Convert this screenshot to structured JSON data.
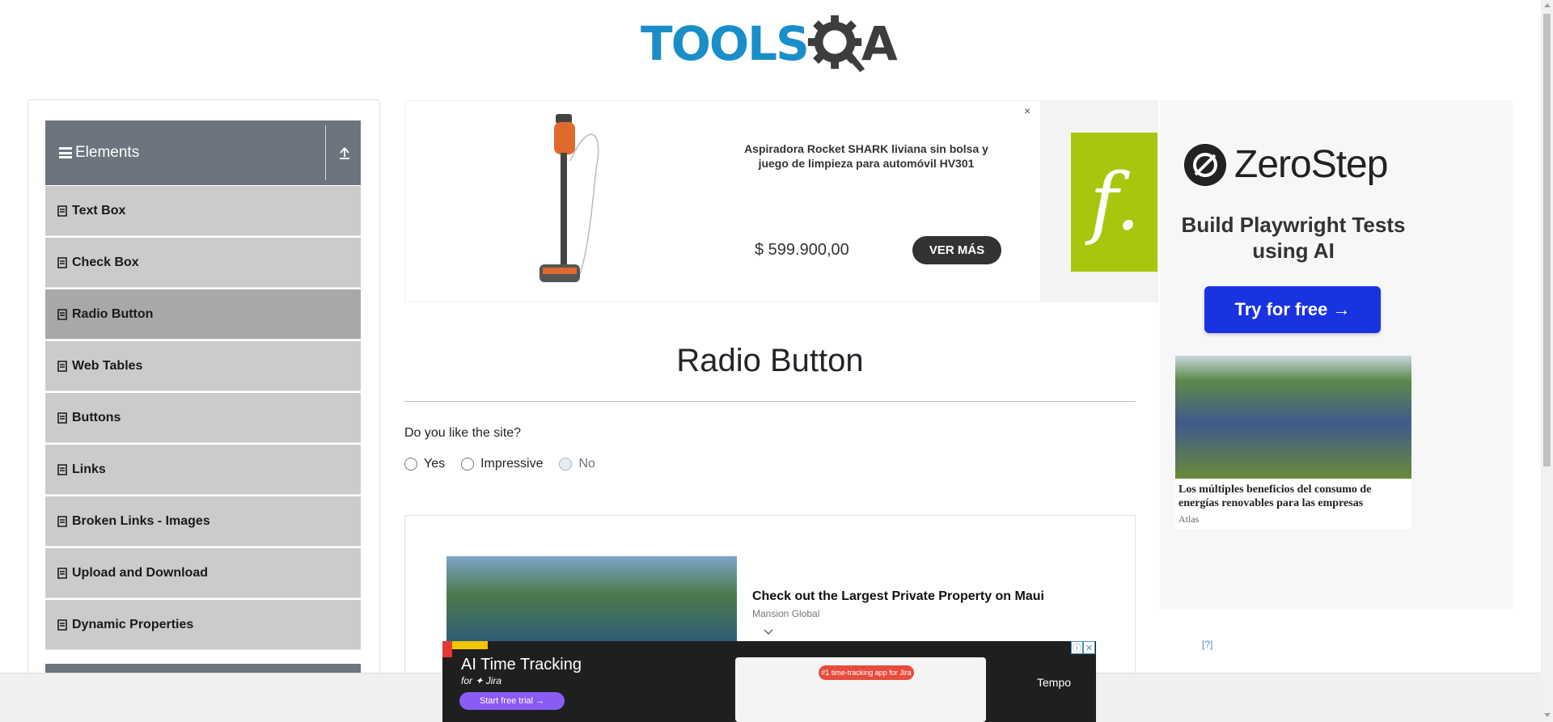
{
  "header": {
    "logo_text": "TOOLS",
    "logo_suffix": "A"
  },
  "sidebar": {
    "group_title": "Elements",
    "items": [
      {
        "label": "Text Box",
        "active": false
      },
      {
        "label": "Check Box",
        "active": false
      },
      {
        "label": "Radio Button",
        "active": true
      },
      {
        "label": "Web Tables",
        "active": false
      },
      {
        "label": "Buttons",
        "active": false
      },
      {
        "label": "Links",
        "active": false
      },
      {
        "label": "Broken Links - Images",
        "active": false
      },
      {
        "label": "Upload and Download",
        "active": false
      },
      {
        "label": "Dynamic Properties",
        "active": false
      }
    ]
  },
  "top_ad": {
    "product_title": "Aspiradora Rocket SHARK liviana sin bolsa y juego de limpieza para automóvil HV301",
    "price": "$ 599.900,00",
    "cta": "VER MÁS",
    "close": "×",
    "brand_glyph": "f.",
    "brand_color": "#a8c70c"
  },
  "main": {
    "title": "Radio Button",
    "question": "Do you like the site?",
    "options": [
      {
        "label": "Yes",
        "disabled": false
      },
      {
        "label": "Impressive",
        "disabled": false
      },
      {
        "label": "No",
        "disabled": true
      }
    ]
  },
  "native_ad": {
    "title": "Check out the Largest Private Property on Maui",
    "source": "Mansion Global"
  },
  "right_ad": {
    "brand": "ZeroStep",
    "tagline": "Build Playwright Tests using AI",
    "cta": "Try for free →",
    "caption": "Los múltiples beneficios del consumo de energías renovables para las empresas",
    "caption_source": "Atlas",
    "cta_color": "#1a33e0"
  },
  "adchoices": "[?]",
  "sticky_ad": {
    "title": "AI Time Tracking",
    "subtitle": "for ✦ Jira",
    "cta": "Start free trial →",
    "pill": "#1 time-tracking app for Jira",
    "brand": "Tempo"
  },
  "colors": {
    "accent_blue": "#1a8ec9",
    "sidebar_header": "#6c757d",
    "sidebar_item": "#cbcbcb",
    "sidebar_active": "#a8a8a8"
  }
}
